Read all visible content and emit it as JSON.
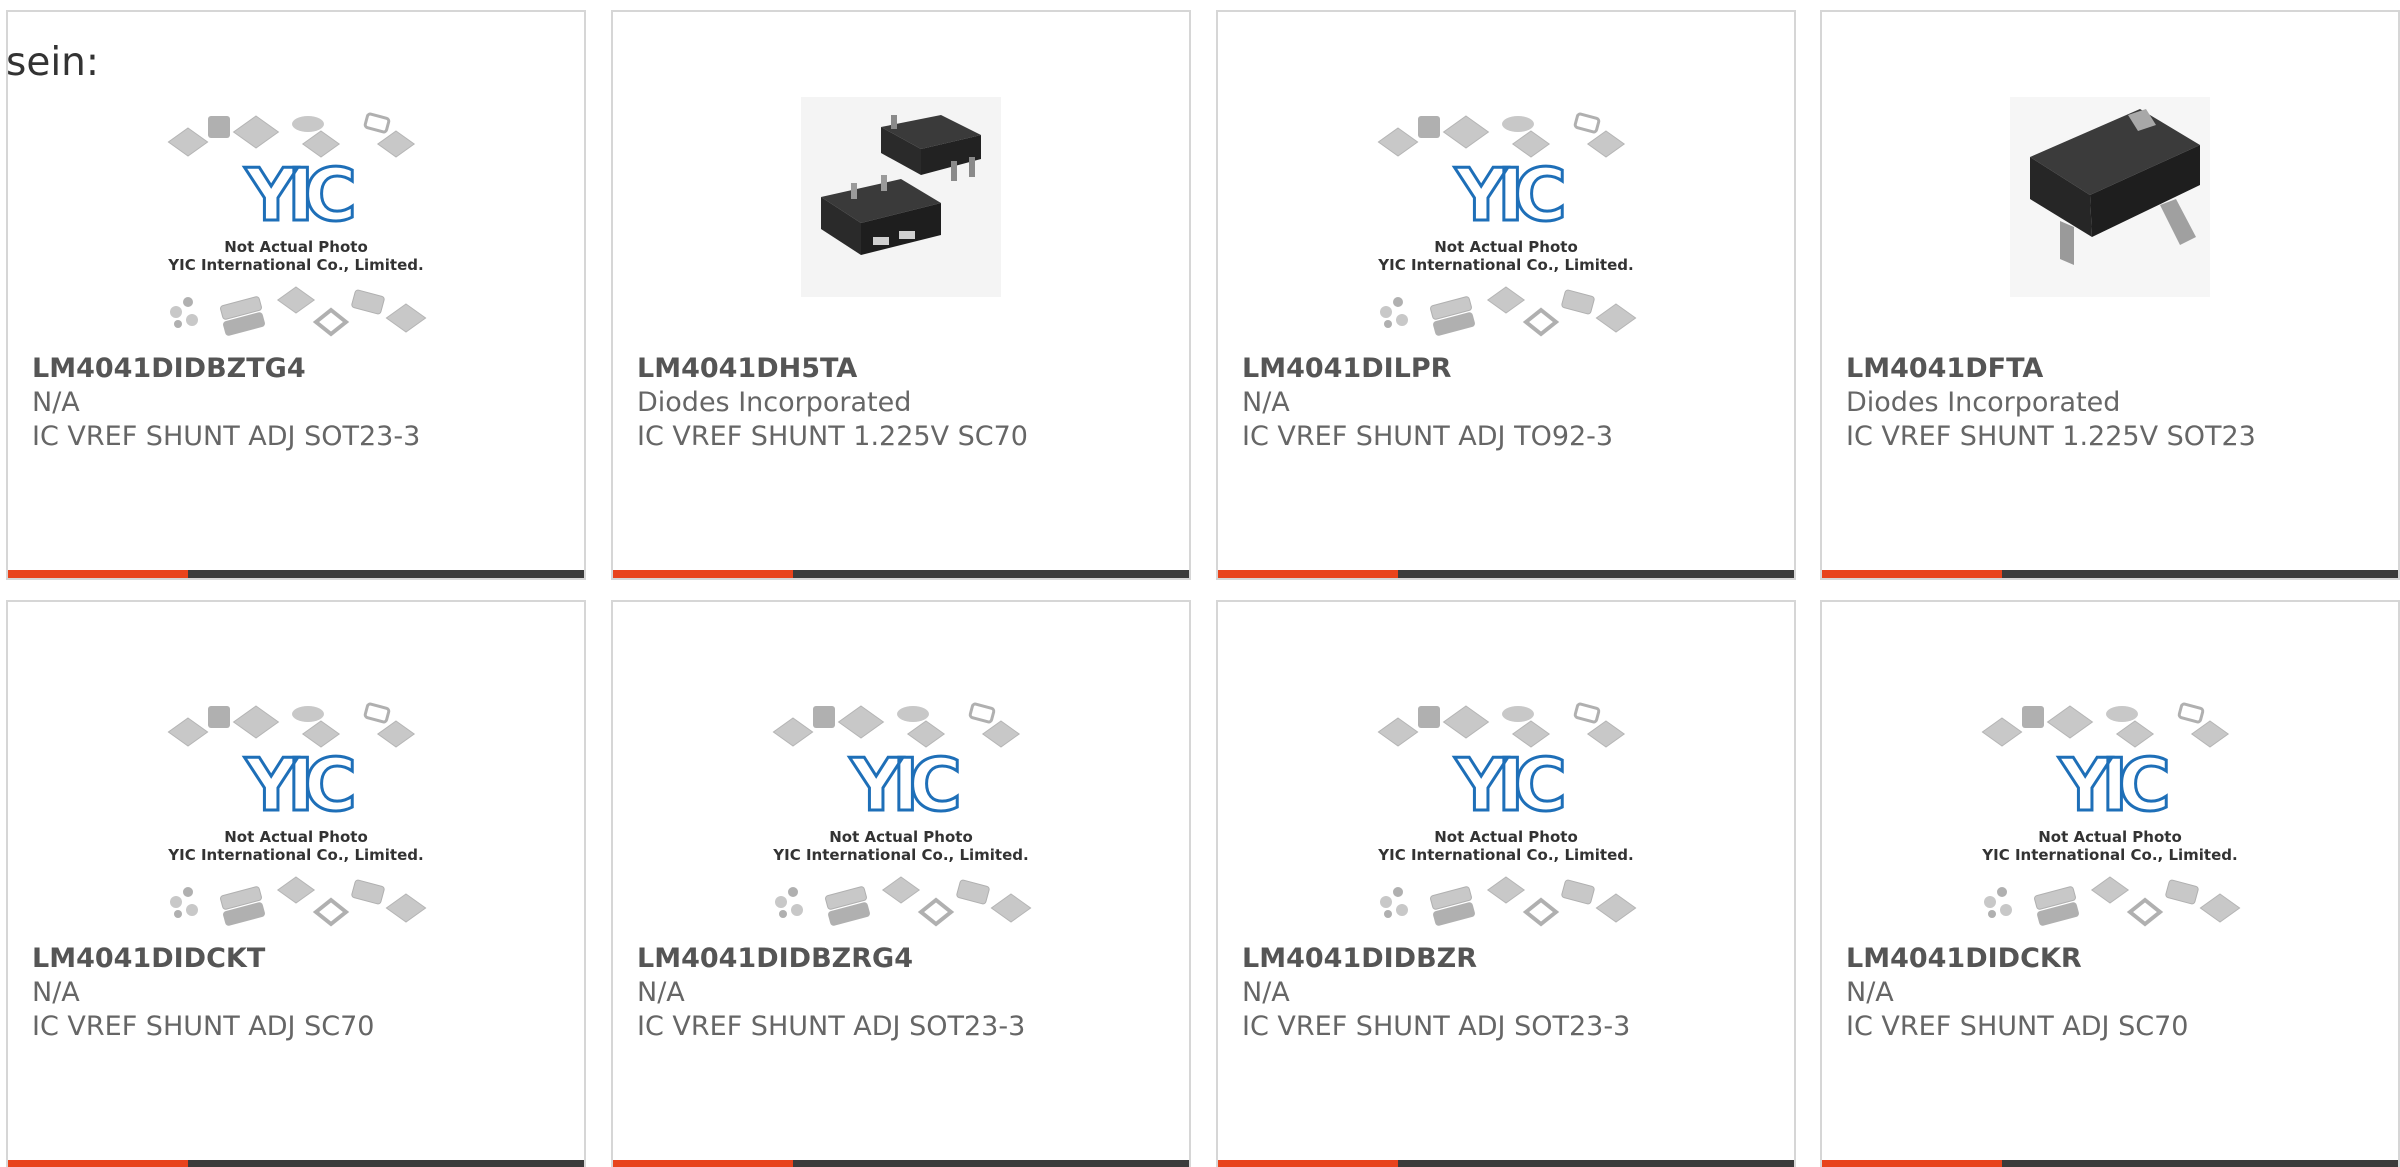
{
  "intro_text": "sein:",
  "accent_color": "#e8431c",
  "bar_color": "#3b3b3b",
  "watermark": {
    "logo_text": "YIC",
    "line1": "Not Actual Photo",
    "line2": "YIC International Co., Limited."
  },
  "products": [
    {
      "part": "LM4041DIDBZTG4",
      "manufacturer": "N/A",
      "description": "IC VREF SHUNT ADJ SOT23-3",
      "image": "placeholder"
    },
    {
      "part": "LM4041DH5TA",
      "manufacturer": "Diodes Incorporated",
      "description": "IC VREF SHUNT 1.225V SC70",
      "image": "sc70-photo"
    },
    {
      "part": "LM4041DILPR",
      "manufacturer": "N/A",
      "description": "IC VREF SHUNT ADJ TO92-3",
      "image": "placeholder"
    },
    {
      "part": "LM4041DFTA",
      "manufacturer": "Diodes Incorporated",
      "description": "IC VREF SHUNT 1.225V SOT23",
      "image": "sot23-photo"
    },
    {
      "part": "LM4041DIDCKT",
      "manufacturer": "N/A",
      "description": "IC VREF SHUNT ADJ SC70",
      "image": "placeholder"
    },
    {
      "part": "LM4041DIDBZRG4",
      "manufacturer": "N/A",
      "description": "IC VREF SHUNT ADJ SOT23-3",
      "image": "placeholder"
    },
    {
      "part": "LM4041DIDBZR",
      "manufacturer": "N/A",
      "description": "IC VREF SHUNT ADJ SOT23-3",
      "image": "placeholder"
    },
    {
      "part": "LM4041DIDCKR",
      "manufacturer": "N/A",
      "description": "IC VREF SHUNT ADJ SC70",
      "image": "placeholder"
    }
  ]
}
